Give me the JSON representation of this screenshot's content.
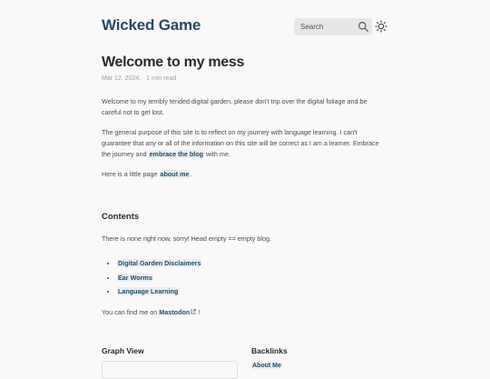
{
  "header": {
    "site_title": "Wicked Game",
    "search_placeholder": "Search",
    "search_icon": "search-icon",
    "theme_icon": "sun-icon"
  },
  "article": {
    "title": "Welcome to my mess",
    "date": "Mar 12, 2024,",
    "read_time": "1 min read",
    "p1": "Welcome to my terribly tended digital garden, please don't trip over the digital foliage and be careful not to get lost.",
    "p2_before": "The general purpose of this site is to reflect on my journey with language learning. I can't guarantee that any or all of the information on this site will be correct as I am a learner. Embrace the journey and ",
    "p2_link": "embrace the blog",
    "p2_after": " with me.",
    "p3_before": "Here is a little page ",
    "p3_link": "about me",
    "p3_after": ".",
    "contents_heading": "Contents",
    "p4": "There is none right now, sorry! Head empty == empty blog.",
    "toc": [
      {
        "label": "Digital Garden Disclaimers"
      },
      {
        "label": "Ear Worms"
      },
      {
        "label": "Language Learning"
      }
    ],
    "p5_before": "You can find me on ",
    "p5_link": "Mastodon",
    "p5_link_icon": "external-link-icon",
    "p5_after": " !"
  },
  "footer": {
    "graph_heading": "Graph View",
    "backlinks_heading": "Backlinks",
    "backlink_item": "About Me"
  },
  "colors": {
    "accent": "#284b63",
    "background": "#faf8f8",
    "text": "#4e4e4e",
    "highlight": "#e9eef3"
  }
}
